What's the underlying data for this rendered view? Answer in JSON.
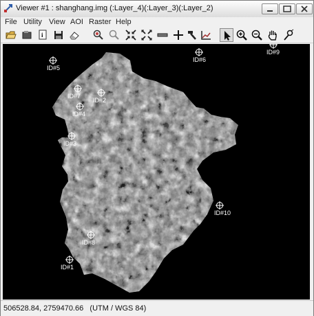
{
  "window": {
    "title": "Viewer #1 : shanghang.img (:Layer_4)(:Layer_3)(:Layer_2)"
  },
  "menu": [
    "File",
    "Utility",
    "View",
    "AOI",
    "Raster",
    "Help"
  ],
  "toolbar": {
    "tools": [
      "open-icon",
      "open-layer-icon",
      "info-icon",
      "save-icon",
      "erase-icon",
      "zoom-in-2x-icon",
      "zoom-out-2x-icon",
      "fit-window-icon",
      "reset-zoom-icon",
      "measure-icon",
      "inquire-cursor-icon",
      "hammer-icon",
      "profile-icon",
      "select-arrow-icon",
      "zoom-in-icon",
      "zoom-out-icon",
      "pan-icon",
      "control-points-icon"
    ],
    "active_tool": "select-arrow-icon"
  },
  "markers": [
    {
      "label": "ID#5"
    },
    {
      "label": "ID#6"
    },
    {
      "label": "ID#9"
    },
    {
      "label": "ID#7"
    },
    {
      "label": "ID#2"
    },
    {
      "label": "ID#4"
    },
    {
      "label": "ID#3"
    },
    {
      "label": "ID#10"
    },
    {
      "label": "ID#8"
    },
    {
      "label": "ID#1"
    }
  ],
  "status": {
    "coordinates": "506528.84, 2759470.66",
    "projection": "(UTM / WGS 84)"
  }
}
